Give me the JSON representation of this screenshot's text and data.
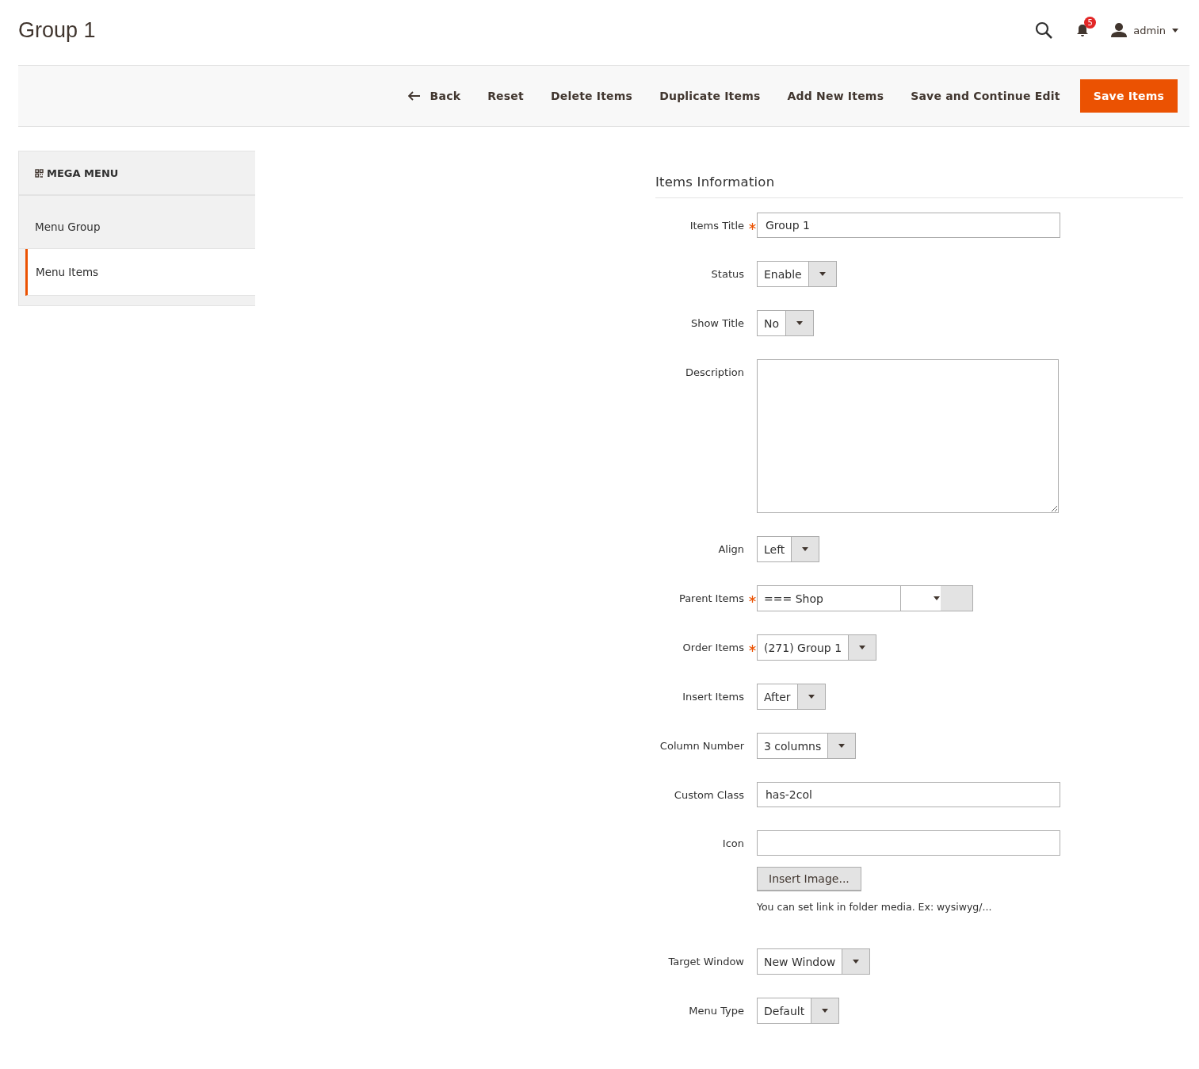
{
  "page_title": "Group 1",
  "header": {
    "notifications_count": "5",
    "user": "admin"
  },
  "toolbar": [
    {
      "label": "Back",
      "kind": "back"
    },
    {
      "label": "Reset",
      "kind": "plain"
    },
    {
      "label": "Delete Items",
      "kind": "plain"
    },
    {
      "label": "Duplicate Items",
      "kind": "plain"
    },
    {
      "label": "Add New Items",
      "kind": "plain"
    },
    {
      "label": "Save and Continue Edit",
      "kind": "plain"
    },
    {
      "label": "Save Items",
      "kind": "primary"
    }
  ],
  "sidebar": {
    "title": "MEGA MENU",
    "items": [
      {
        "label": "Menu Group",
        "selected": false
      },
      {
        "label": "Menu Items",
        "selected": true
      }
    ]
  },
  "form": {
    "title": "Items Information",
    "fields": [
      {
        "label": "Items Title",
        "required": true,
        "kind": "text",
        "value": "Group 1"
      },
      {
        "label": "Status",
        "required": false,
        "kind": "select",
        "value": "Enable"
      },
      {
        "label": "Show Title",
        "required": false,
        "kind": "select",
        "value": "No"
      },
      {
        "label": "Description",
        "required": false,
        "kind": "textarea"
      },
      {
        "label": "Align",
        "required": false,
        "kind": "select",
        "value": "Left"
      },
      {
        "label": "Parent Items",
        "required": true,
        "kind": "select",
        "value": "=== Shop"
      },
      {
        "label": "Order Items",
        "required": true,
        "kind": "select",
        "value": "(271) Group 1"
      },
      {
        "label": "Insert Items",
        "required": false,
        "kind": "select",
        "value": "After"
      },
      {
        "label": "Column Number",
        "required": false,
        "kind": "select",
        "value": "3 columns"
      },
      {
        "label": "Custom Class",
        "required": false,
        "kind": "text",
        "value": "has-2col"
      },
      {
        "label": "Icon",
        "required": false,
        "kind": "image",
        "button": "Insert Image...",
        "note": "You can set link in folder media. Ex: wysiwyg/..."
      },
      {
        "label": "Target Window",
        "required": false,
        "kind": "select",
        "value": "New Window"
      },
      {
        "label": "Menu Type",
        "required": false,
        "kind": "select",
        "value": "Default"
      }
    ]
  }
}
